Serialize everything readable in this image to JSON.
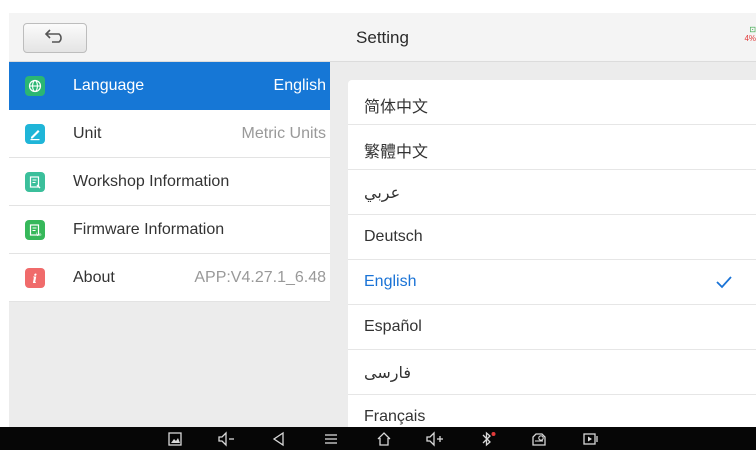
{
  "header": {
    "title": "Setting",
    "battery_top": "⊡",
    "battery_pct": "4%"
  },
  "menu": {
    "items": [
      {
        "label": "Language",
        "value": "English",
        "icon": "globe-icon",
        "icon_color": "#2bb673",
        "active": true
      },
      {
        "label": "Unit",
        "value": "Metric Units",
        "icon": "pencil-icon",
        "icon_color": "#1fb5d8",
        "active": false
      },
      {
        "label": "Workshop Information",
        "value": "",
        "icon": "document-edit-icon",
        "icon_color": "#3bbf9b",
        "active": false
      },
      {
        "label": "Firmware Information",
        "value": "",
        "icon": "document-version-icon",
        "icon_color": "#36b85a",
        "active": false
      },
      {
        "label": "About",
        "value": "APP:V4.27.1_6.48",
        "icon": "info-icon",
        "icon_color": "#f06b6b",
        "active": false
      }
    ]
  },
  "languages": {
    "selected": "English",
    "items": [
      "简体中文",
      "繁體中文",
      "عربي",
      "Deutsch",
      "English",
      "Español",
      "فارسی",
      "Français"
    ]
  },
  "colors": {
    "accent": "#1677d6",
    "selected_text": "#1a73d6"
  },
  "navbar": {
    "icons": [
      "screenshot-icon",
      "volume-down-icon",
      "back-icon",
      "menu-icon",
      "home-icon",
      "volume-up-icon",
      "bluetooth-icon",
      "vci-icon",
      "screen-record-icon"
    ]
  }
}
